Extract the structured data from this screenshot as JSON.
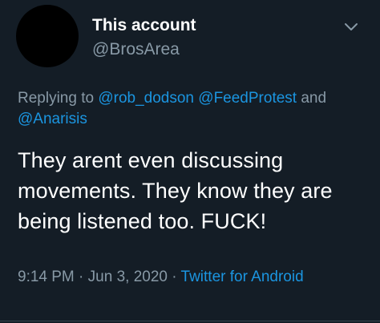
{
  "author": {
    "display_name": "This account",
    "handle": "@BrosArea"
  },
  "reply": {
    "prefix": "Replying to",
    "mentions": [
      "@rob_dodson",
      "@FeedProtest",
      "@Anarisis"
    ],
    "conjunction": "and"
  },
  "tweet": {
    "text": "They arent even discussing movements. They know they are being listened too. FUCK!"
  },
  "meta": {
    "time": "9:14 PM",
    "separator": "·",
    "date": "Jun 3, 2020",
    "source": "Twitter for Android"
  },
  "icons": {
    "menu": "chevron-down-icon"
  },
  "colors": {
    "background": "#141d26",
    "link": "#1b95e0",
    "secondary_text": "#8899a6",
    "primary_text": "#ffffff"
  }
}
